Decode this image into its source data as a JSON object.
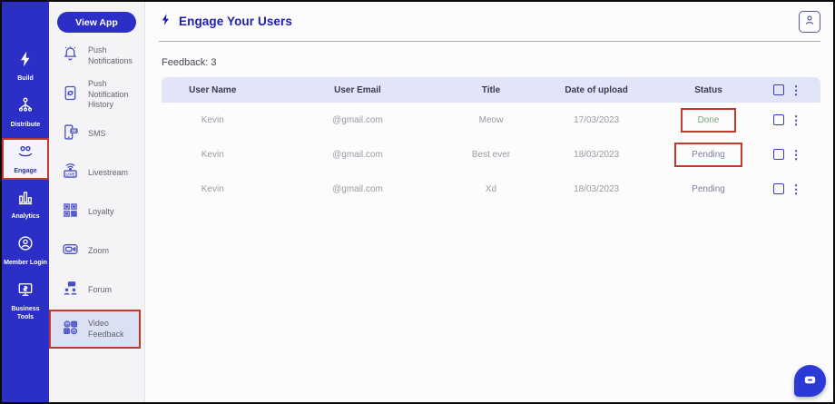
{
  "header": {
    "title": "Engage Your Users",
    "feedback_label": "Feedback: 3"
  },
  "left_sidebar": {
    "items": [
      {
        "label": "Build",
        "icon": "lightning-icon",
        "active": false
      },
      {
        "label": "Distribute",
        "icon": "distribute-icon",
        "active": false
      },
      {
        "label": "Engage",
        "icon": "engage-users-icon",
        "active": true,
        "annotated": true
      },
      {
        "label": "Analytics",
        "icon": "bar-chart-icon",
        "active": false
      },
      {
        "label": "Member Login",
        "icon": "member-login-icon",
        "active": false
      },
      {
        "label": "Business Tools",
        "icon": "business-tools-icon",
        "active": false
      }
    ]
  },
  "sub_sidebar": {
    "view_app_label": "View App",
    "items": [
      {
        "label": "Push Notifications",
        "icon": "bell-icon"
      },
      {
        "label": "Push Notification History",
        "icon": "notification-history-icon"
      },
      {
        "label": "SMS",
        "icon": "sms-icon"
      },
      {
        "label": "Livestream",
        "icon": "livestream-icon"
      },
      {
        "label": "Loyalty",
        "icon": "loyalty-icon"
      },
      {
        "label": "Zoom",
        "icon": "zoom-camera-icon"
      },
      {
        "label": "Forum",
        "icon": "forum-icon"
      },
      {
        "label": "Video Feedback",
        "icon": "video-feedback-icon",
        "active": true,
        "annotated": true
      }
    ]
  },
  "table": {
    "headers": [
      "User Name",
      "User Email",
      "Title",
      "Date of upload",
      "Status"
    ],
    "rows": [
      {
        "user_name": "Kevin",
        "user_email": "@gmail.com",
        "title": "Meow",
        "date_of_upload": "17/03/2023",
        "status": "Done",
        "status_annotated": true
      },
      {
        "user_name": "Kevin",
        "user_email": "@gmail.com",
        "title": "Best ever",
        "date_of_upload": "18/03/2023",
        "status": "Pending",
        "status_annotated": true
      },
      {
        "user_name": "Kevin",
        "user_email": "@gmail.com",
        "title": "Xd",
        "date_of_upload": "18/03/2023",
        "status": "Pending",
        "status_annotated": false
      }
    ]
  },
  "icons": {
    "kebab": "⋮",
    "livestream_text": "LIVE"
  },
  "colors": {
    "sidebar_blue": "#2b2fc6",
    "annotation_red": "#c0392b",
    "status_done_green": "#74a877",
    "status_pending_gray": "#7d80a0",
    "table_header_bg": "#e2e5f7",
    "active_item_lavender": "#dce0f3"
  }
}
